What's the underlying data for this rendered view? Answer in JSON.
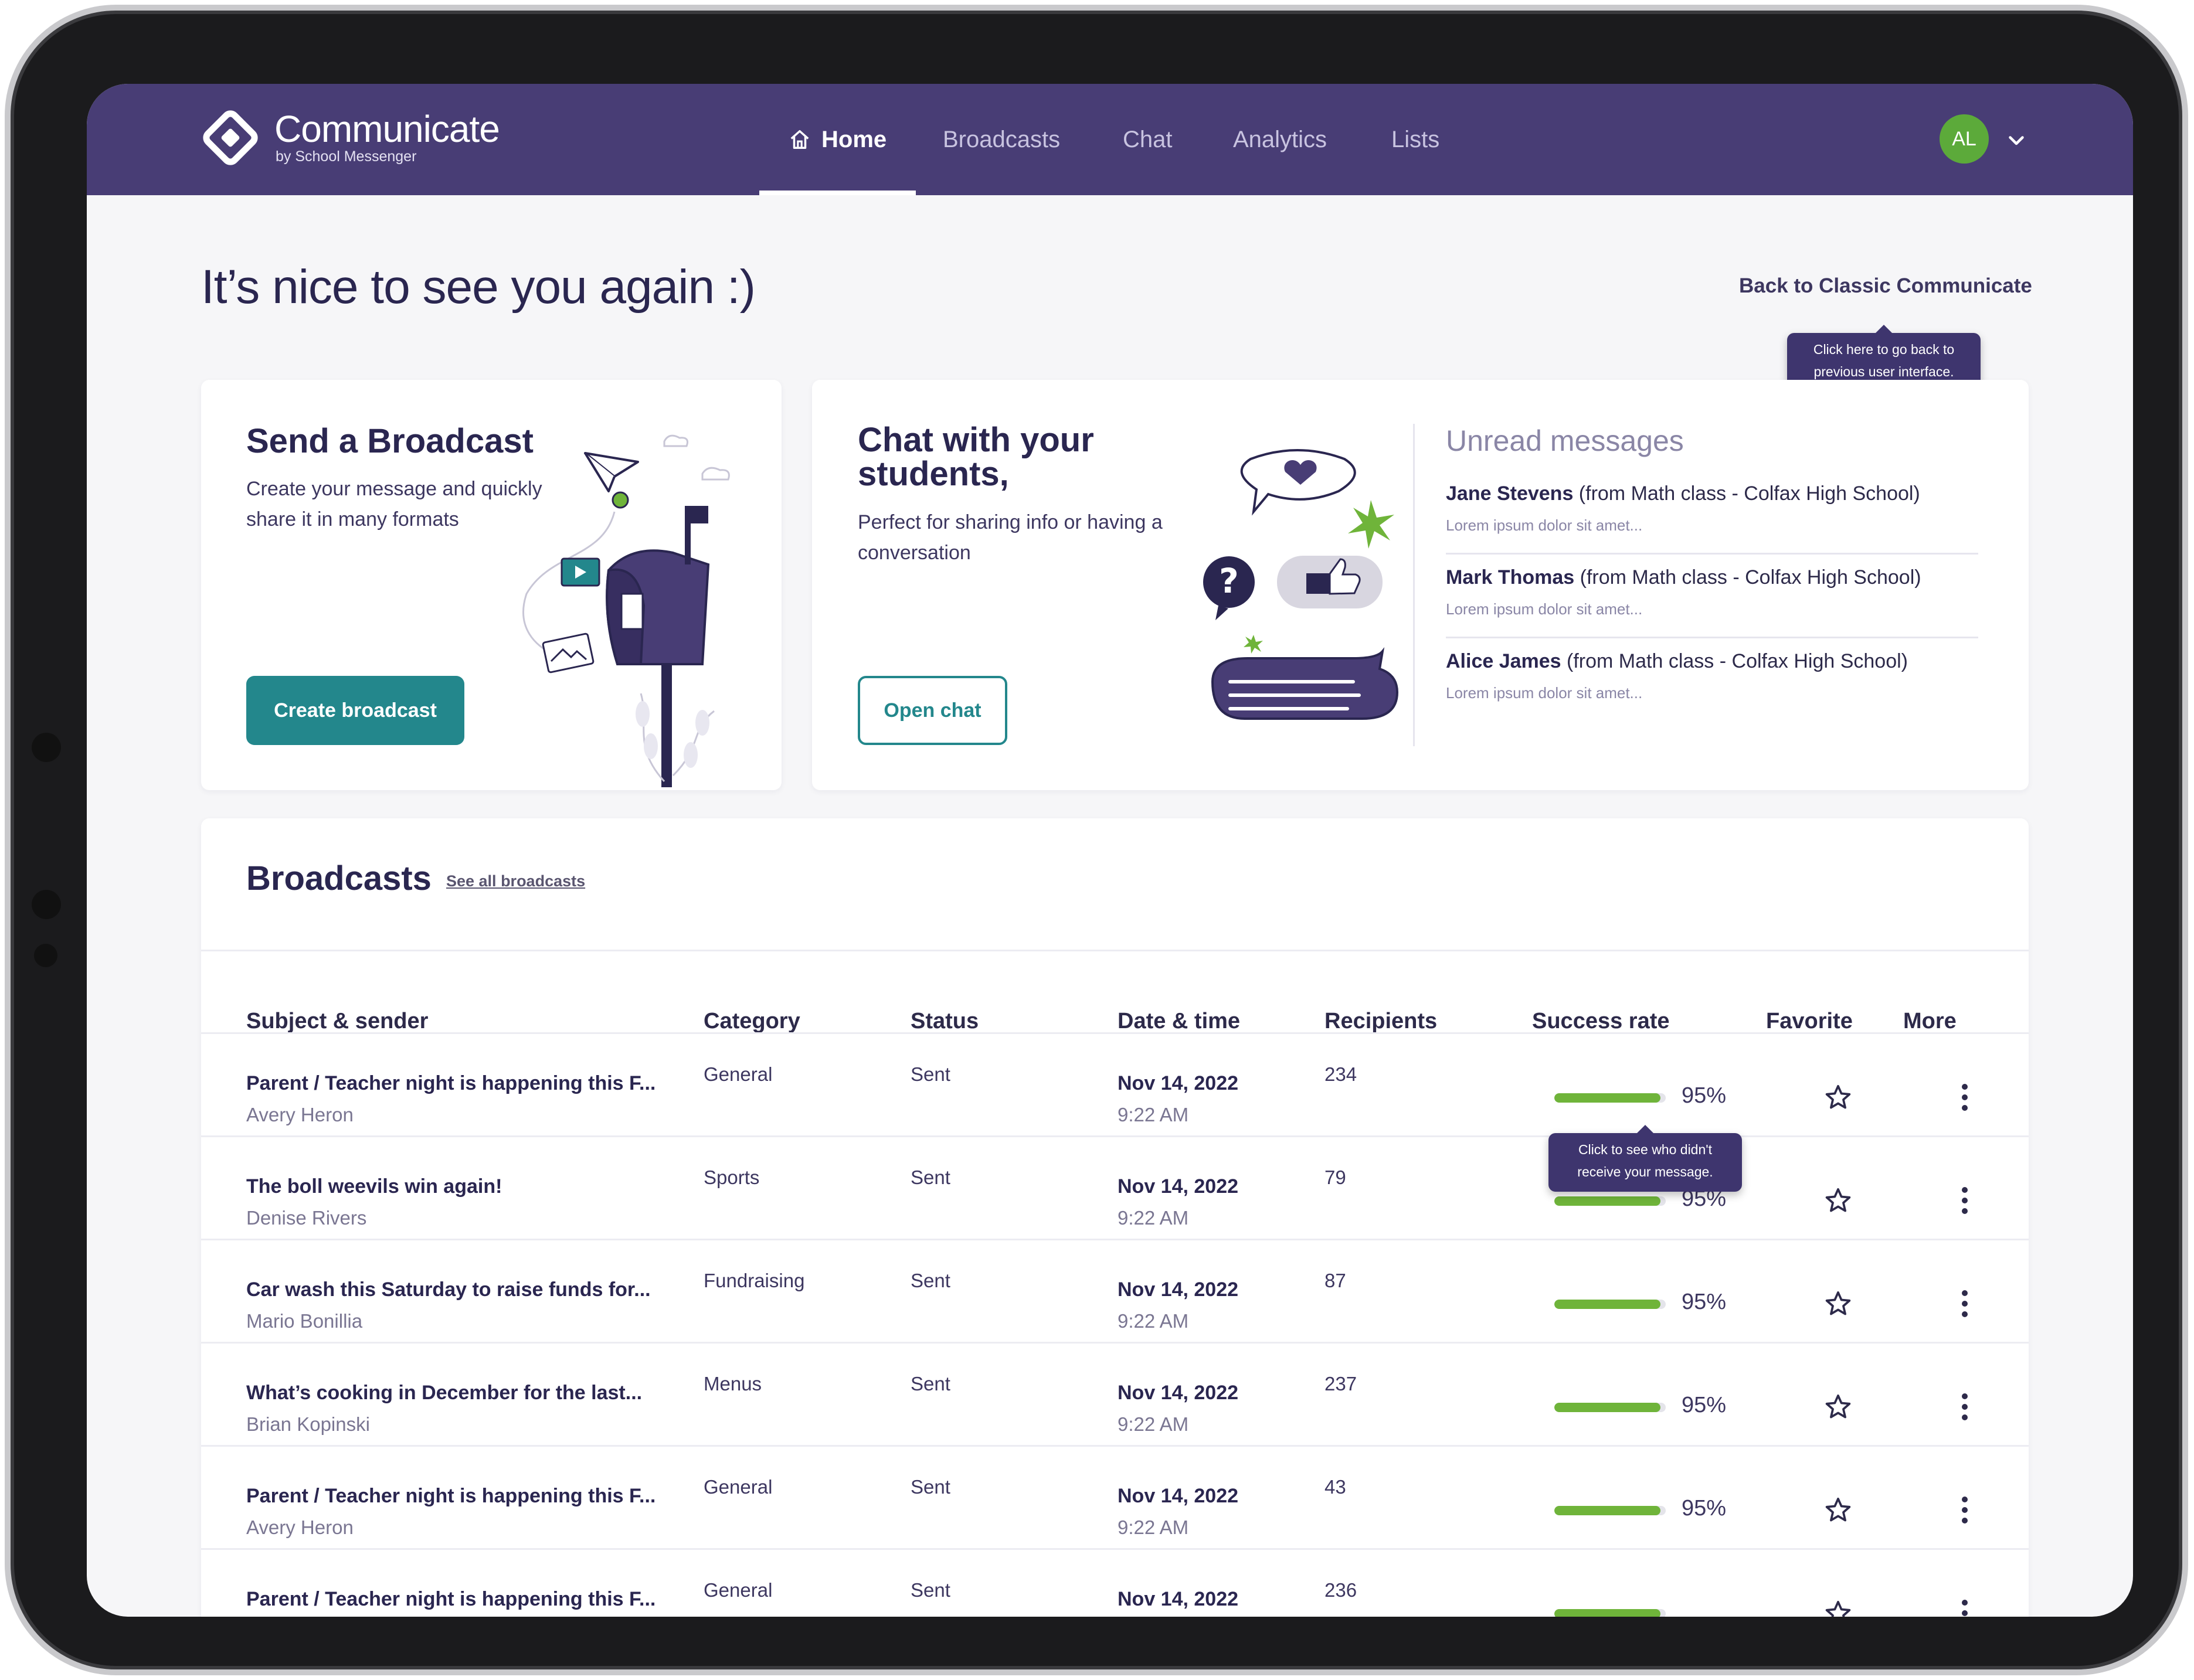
{
  "brand": {
    "name": "Communicate",
    "subtitle": "by School Messenger"
  },
  "nav": {
    "items": [
      {
        "label": "Home",
        "active": true,
        "icon": "home-icon"
      },
      {
        "label": "Broadcasts",
        "active": false
      },
      {
        "label": "Chat",
        "active": false
      },
      {
        "label": "Analytics",
        "active": false
      },
      {
        "label": "Lists",
        "active": false
      }
    ]
  },
  "user": {
    "initials": "AL",
    "avatar_color": "#5caa3a"
  },
  "greeting": "It’s nice to see you again :)",
  "classic_link": {
    "label": "Back to Classic Communicate",
    "tooltip_line1": "Click here to go back to",
    "tooltip_line2": "previous user interface."
  },
  "broadcast_card": {
    "title": "Send a Broadcast",
    "desc_line1": "Create your message and quickly",
    "desc_line2": "share it in many formats",
    "button": "Create broadcast"
  },
  "chat_card": {
    "title_line1": "Chat with your",
    "title_line2": "students,",
    "desc_line1": "Perfect for sharing info or having a",
    "desc_line2": "conversation",
    "button": "Open chat",
    "unread_title": "Unread messages",
    "messages": [
      {
        "name": "Jane Stevens",
        "source": " (from Math class - Colfax High School)",
        "preview": "Lorem ipsum dolor sit amet..."
      },
      {
        "name": "Mark Thomas",
        "source": " (from Math class - Colfax High School)",
        "preview": "Lorem ipsum dolor sit amet..."
      },
      {
        "name": "Alice James",
        "source": " (from Math class - Colfax High School)",
        "preview": "Lorem ipsum dolor sit amet..."
      }
    ]
  },
  "broadcasts": {
    "title": "Broadcasts",
    "see_all": "See all broadcasts",
    "columns": [
      "Subject & sender",
      "Category",
      "Status",
      "Date & time",
      "Recipients",
      "Success rate",
      "Favorite",
      "More"
    ],
    "success_tooltip_line1": "Click to see who didn't",
    "success_tooltip_line2": "receive your message.",
    "rows": [
      {
        "subject": "Parent / Teacher night is happening this F...",
        "sender": "Avery Heron",
        "category": "General",
        "status": "Sent",
        "date": "Nov 14, 2022",
        "time": "9:22 AM",
        "recipients": "234",
        "success": "95%",
        "success_value": 0.95
      },
      {
        "subject": "The boll weevils win again!",
        "sender": "Denise Rivers",
        "category": "Sports",
        "status": "Sent",
        "date": "Nov 14, 2022",
        "time": "9:22 AM",
        "recipients": "79",
        "success": "95%",
        "success_value": 0.95
      },
      {
        "subject": "Car wash this Saturday to raise funds for...",
        "sender": "Mario Bonillia",
        "category": "Fundraising",
        "status": "Sent",
        "date": "Nov 14, 2022",
        "time": "9:22 AM",
        "recipients": "87",
        "success": "95%",
        "success_value": 0.95
      },
      {
        "subject": "What’s cooking in December for the last...",
        "sender": "Brian Kopinski",
        "category": "Menus",
        "status": "Sent",
        "date": "Nov 14, 2022",
        "time": "9:22 AM",
        "recipients": "237",
        "success": "95%",
        "success_value": 0.95
      },
      {
        "subject": "Parent / Teacher night is happening this F...",
        "sender": "Avery Heron",
        "category": "General",
        "status": "Sent",
        "date": "Nov 14, 2022",
        "time": "9:22 AM",
        "recipients": "43",
        "success": "95%",
        "success_value": 0.95
      },
      {
        "subject": "Parent / Teacher night is happening this F...",
        "sender": "",
        "category": "General",
        "status": "Sent",
        "date": "Nov 14, 2022",
        "time": "",
        "recipients": "236",
        "success": "",
        "success_value": 0.95
      }
    ]
  },
  "colors": {
    "header": "#483d75",
    "accent_teal": "#23878c",
    "success_green": "#6fb43a",
    "tooltip": "#3e356e"
  }
}
